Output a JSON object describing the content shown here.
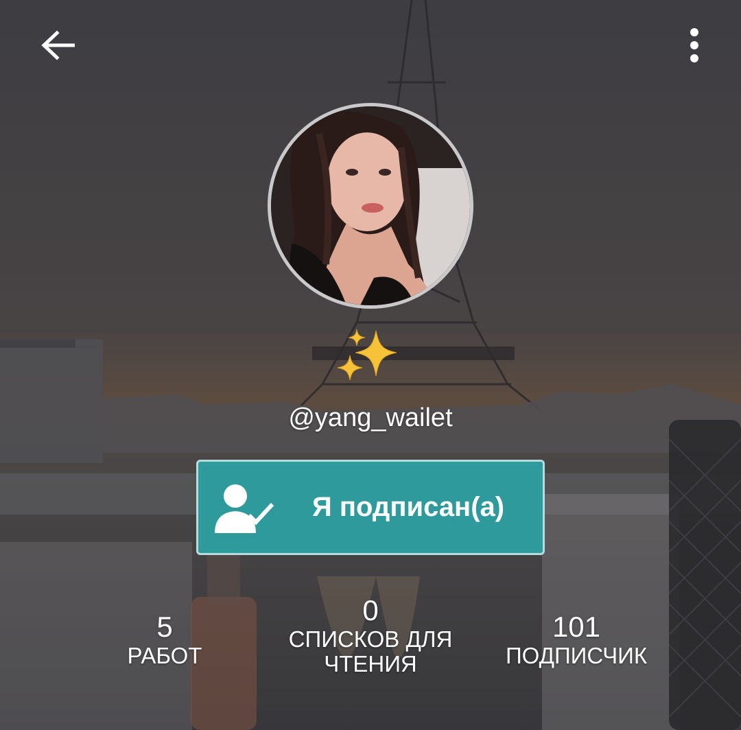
{
  "header": {
    "back_icon": "arrow-left-icon",
    "menu_icon": "more-vertical-icon"
  },
  "profile": {
    "bio_emoji": "✨",
    "username": "@yang_wailet"
  },
  "follow_button": {
    "label": "Я подписан(а)",
    "icon": "user-check-icon",
    "color": "#2e9a9c"
  },
  "stats": {
    "works": {
      "value": "5",
      "label": "РАБОТ"
    },
    "reading_lists": {
      "value": "0",
      "label": "СПИСКОВ ДЛЯ ЧТЕНИЯ"
    },
    "followers": {
      "value": "101",
      "label": "ПОДПИСЧИК"
    }
  }
}
